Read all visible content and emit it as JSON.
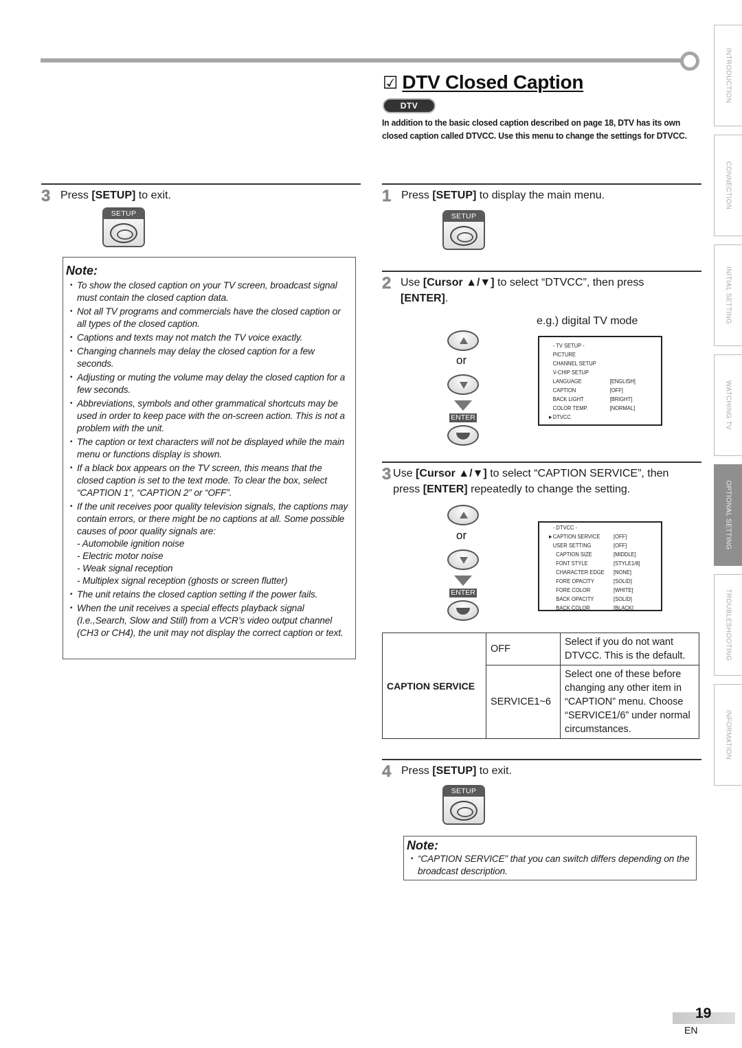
{
  "header": {
    "title": "DTV Closed Caption",
    "check_glyph": "☑",
    "badge": "DTV",
    "intro": "In addition to the basic closed caption described on page 18, DTV has its own closed caption called DTVCC. Use this menu to change the settings for DTVCC."
  },
  "left": {
    "step3": {
      "num": "3",
      "pre": "Press ",
      "key": "[SETUP]",
      "post": " to exit.",
      "button_label": "SETUP"
    },
    "note": {
      "title": "Note:",
      "items": [
        "To show the closed caption on your TV screen, broadcast signal must contain the closed caption data.",
        "Not all TV programs and commercials have the closed caption or all types of the closed caption.",
        "Captions and texts may not match the TV voice exactly.",
        "Changing channels may delay the closed caption for a few seconds.",
        "Adjusting or muting the volume may delay the closed caption for a few seconds.",
        "Abbreviations, symbols and other grammatical shortcuts may be used in order to keep pace with the on-screen action. This is not a problem with the unit.",
        "The caption or text characters will not be displayed while the main menu or functions display is shown.",
        "If a black box appears on the TV screen, this means that the closed caption is set to the text mode. To clear the box, select “CAPTION 1”, “CAPTION 2” or “OFF”.",
        "If the unit receives poor quality television signals, the captions may contain errors, or there might be no captions at all. Some possible causes of poor quality signals are:",
        "The unit retains the closed caption setting if the power fails.",
        "When the unit receives a special effects playback signal (I.e.,Search, Slow and Still) from a VCR’s video output channel (CH3 or CH4), the unit may not display the correct caption or text."
      ],
      "causes": [
        "- Automobile ignition noise",
        "- Electric motor noise",
        "- Weak signal reception",
        "- Multiplex signal reception (ghosts or screen flutter)"
      ]
    }
  },
  "right": {
    "step1": {
      "num": "1",
      "pre": "Press ",
      "key": "[SETUP]",
      "post": " to display the main menu.",
      "button_label": "SETUP"
    },
    "step2": {
      "num": "2",
      "pre": "Use ",
      "key": "[Cursor ▲/▼]",
      "mid": " to select “DTVCC”, then press ",
      "key2": "[ENTER]",
      "post": "."
    },
    "example_label": "e.g.) digital TV mode",
    "or_label": "or",
    "enter_label": "ENTER",
    "tv_setup_menu": {
      "title": "-  TV SETUP  -",
      "rows": [
        {
          "label": "PICTURE",
          "value": ""
        },
        {
          "label": "CHANNEL SETUP",
          "value": ""
        },
        {
          "label": "V-CHIP  SETUP",
          "value": ""
        },
        {
          "label": "LANGUAGE",
          "value": "[ENGLISH]"
        },
        {
          "label": "CAPTION",
          "value": "[OFF]"
        },
        {
          "label": "BACK  LIGHT",
          "value": "[BRIGHT]"
        },
        {
          "label": "COLOR  TEMP.",
          "value": "[NORMAL]"
        },
        {
          "label": "DTVCC",
          "value": "",
          "selected": true
        }
      ]
    },
    "step3": {
      "num": "3",
      "pre": "Use ",
      "key": "[Cursor ▲/▼]",
      "mid": " to select “CAPTION SERVICE”, then press ",
      "key2": "[ENTER]",
      "post": " repeatedly to change the setting."
    },
    "dtvcc_menu": {
      "title": "- DTVCC -",
      "rows": [
        {
          "label": "CAPTION SERVICE",
          "value": "[OFF]",
          "selected": true
        },
        {
          "label": "USER SETTING",
          "value": "[OFF]"
        },
        {
          "label": "CAPTION SIZE",
          "value": "[MIDDLE]"
        },
        {
          "label": "FONT STYLE",
          "value": "[STYLE1/8]"
        },
        {
          "label": "CHARACTER EDGE",
          "value": "[NONE]"
        },
        {
          "label": "FORE OPACITY",
          "value": "[SOLID]"
        },
        {
          "label": "FORE COLOR",
          "value": "[WHITE]"
        },
        {
          "label": "BACK OPACITY",
          "value": "[SOLID]"
        },
        {
          "label": "BACK COLOR",
          "value": "[BLACK]"
        }
      ]
    },
    "table": {
      "header": "CAPTION SERVICE",
      "rows": [
        {
          "option": "OFF",
          "desc": "Select if you do not want DTVCC. This is the default."
        },
        {
          "option": "SERVICE1~6",
          "desc": "Select one of these before changing any other item in “CAPTION” menu. Choose “SERVICE1/6” under normal circumstances."
        }
      ]
    },
    "step4": {
      "num": "4",
      "pre": "Press ",
      "key": "[SETUP]",
      "post": " to exit.",
      "button_label": "SETUP"
    },
    "note": {
      "title": "Note:",
      "items": [
        "“CAPTION SERVICE” that you can switch differs depending on the broadcast description."
      ]
    }
  },
  "side_tabs": [
    {
      "label": "INTRODUCTION",
      "active": false
    },
    {
      "label": "CONNECTION",
      "active": false
    },
    {
      "label": "INITIAL  SETTING",
      "active": false
    },
    {
      "label": "WATCHING  TV",
      "active": false
    },
    {
      "label": "OPTIONAL  SETTING",
      "active": true
    },
    {
      "label": "TROUBLESHOOTING",
      "active": false
    },
    {
      "label": "INFORMATION",
      "active": false
    }
  ],
  "footer": {
    "page_number": "19",
    "language": "EN"
  },
  "colors": {
    "accent_gray": "#a6a6a6",
    "active_tab": "#8f8f8f",
    "step_number": "#8a8a8a"
  }
}
